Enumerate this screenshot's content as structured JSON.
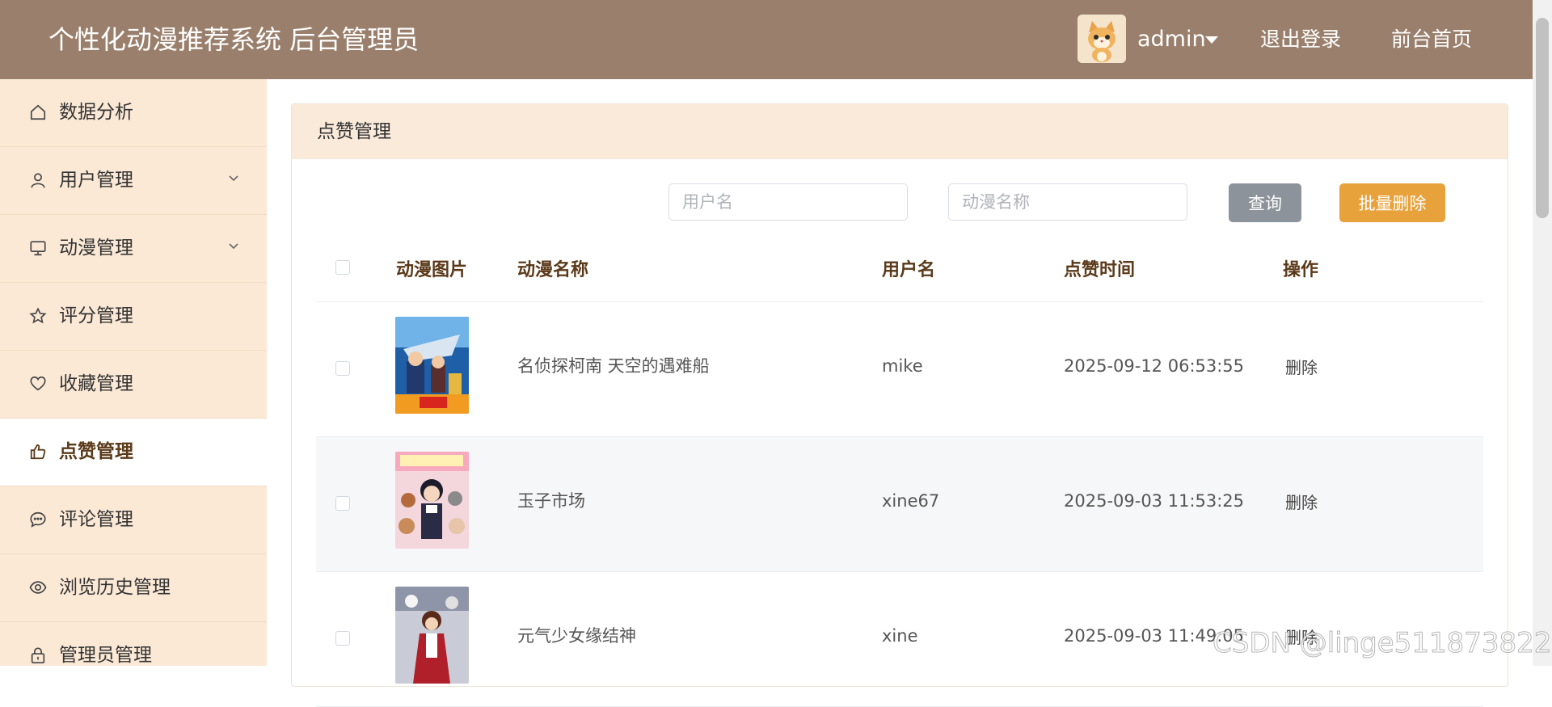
{
  "header": {
    "title": "个性化动漫推荐系统 后台管理员",
    "user": "admin",
    "logout": "退出登录",
    "home": "前台首页"
  },
  "sidebar": {
    "items": [
      {
        "label": "数据分析",
        "icon": "home-icon"
      },
      {
        "label": "用户管理",
        "icon": "user-icon"
      },
      {
        "label": "动漫管理",
        "icon": "monitor-icon"
      },
      {
        "label": "评分管理",
        "icon": "star-icon"
      },
      {
        "label": "收藏管理",
        "icon": "heart-icon"
      },
      {
        "label": "点赞管理",
        "icon": "thumbs-up-icon"
      },
      {
        "label": "评论管理",
        "icon": "chat-icon"
      },
      {
        "label": "浏览历史管理",
        "icon": "eye-icon"
      },
      {
        "label": "管理员管理",
        "icon": "lock-icon"
      }
    ]
  },
  "main": {
    "title": "点赞管理",
    "search": {
      "username_placeholder": "用户名",
      "anime_placeholder": "动漫名称",
      "query_label": "查询",
      "bulk_delete_label": "批量删除"
    },
    "table": {
      "columns": [
        "动漫图片",
        "动漫名称",
        "用户名",
        "点赞时间",
        "操作"
      ],
      "rows": [
        {
          "anime": "名侦探柯南 天空的遇难船",
          "user": "mike",
          "time": "2025-09-12 06:53:55",
          "action": "删除"
        },
        {
          "anime": "玉子市场",
          "user": "xine67",
          "time": "2025-09-03 11:53:25",
          "action": "删除"
        },
        {
          "anime": "元气少女缘结神",
          "user": "xine",
          "time": "2025-09-03 11:49:05",
          "action": "删除"
        }
      ]
    }
  },
  "watermark": "CSDN @linge511873822",
  "colors": {
    "header_bg": "#9a806c",
    "sidebar_bg": "#fbe9d6",
    "card_header_bg": "#faeada",
    "query_button": "#8d939a",
    "bulk_delete_button": "#e8a23c"
  }
}
